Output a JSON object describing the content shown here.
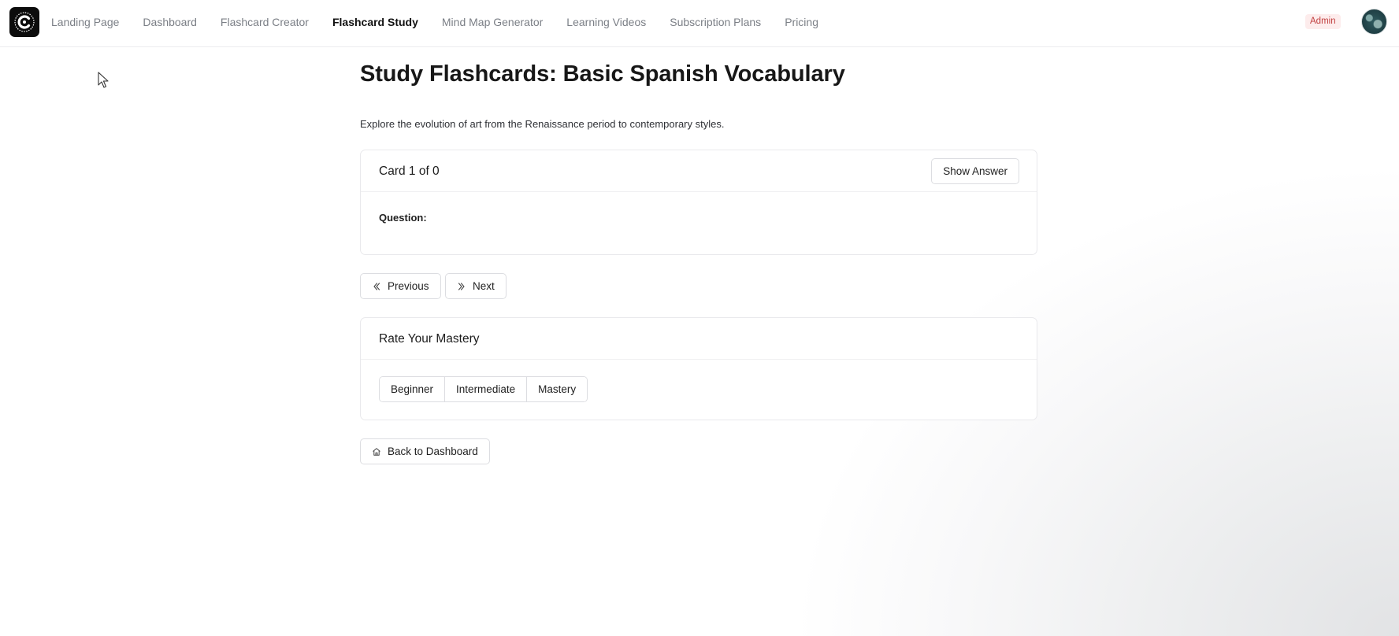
{
  "nav": {
    "items": [
      {
        "label": "Landing Page",
        "active": false
      },
      {
        "label": "Dashboard",
        "active": false
      },
      {
        "label": "Flashcard Creator",
        "active": false
      },
      {
        "label": "Flashcard Study",
        "active": true
      },
      {
        "label": "Mind Map Generator",
        "active": false
      },
      {
        "label": "Learning Videos",
        "active": false
      },
      {
        "label": "Subscription Plans",
        "active": false
      },
      {
        "label": "Pricing",
        "active": false
      }
    ],
    "role_badge": "Admin"
  },
  "page": {
    "title": "Study Flashcards: Basic Spanish Vocabulary",
    "description": "Explore the evolution of art from the Renaissance period to contemporary styles."
  },
  "flashcard": {
    "counter": "Card 1 of 0",
    "show_answer_label": "Show Answer",
    "question_label": "Question:"
  },
  "navigation": {
    "previous_label": "Previous",
    "next_label": "Next"
  },
  "mastery": {
    "title": "Rate Your Mastery",
    "options": [
      "Beginner",
      "Intermediate",
      "Mastery"
    ]
  },
  "footer": {
    "back_label": "Back to Dashboard"
  },
  "colors": {
    "admin_badge_bg": "#fdecec",
    "admin_badge_text": "#c24141",
    "active_nav": "#111111",
    "inactive_nav": "#7b7f86"
  }
}
